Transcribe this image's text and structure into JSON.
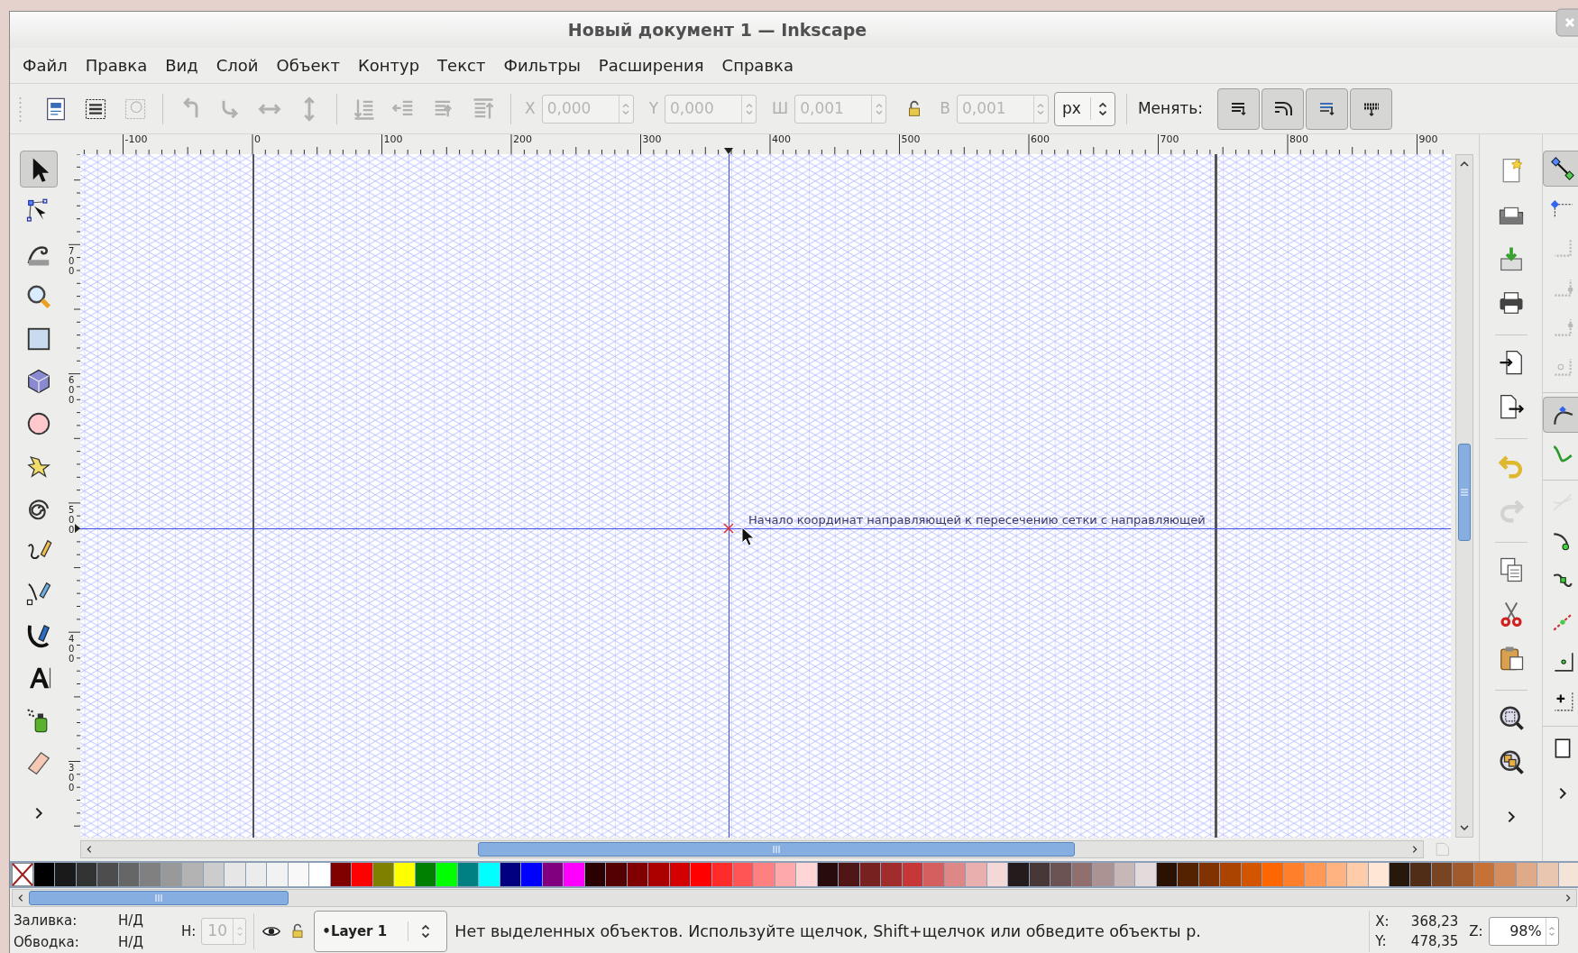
{
  "window": {
    "title": "Новый документ 1 — Inkscape"
  },
  "menu": [
    "Файл",
    "Правка",
    "Вид",
    "Слой",
    "Объект",
    "Контур",
    "Текст",
    "Фильтры",
    "Расширения",
    "Справка"
  ],
  "toolbar": {
    "buttons": [
      {
        "disabled": false
      },
      {
        "disabled": false
      },
      {
        "disabled": true
      },
      {
        "disabled": true
      },
      {
        "disabled": true
      },
      {
        "disabled": true
      },
      {
        "disabled": true
      },
      {
        "disabled": true
      },
      {
        "disabled": true
      },
      {
        "disabled": true
      },
      {
        "disabled": true
      }
    ],
    "fields": [
      {
        "label": "X",
        "value": "0,000",
        "disabled": true
      },
      {
        "label": "Y",
        "value": "0,000",
        "disabled": true
      },
      {
        "label": "Ш",
        "value": "0,001",
        "disabled": true
      },
      {
        "label": "В",
        "value": "0,001",
        "disabled": true
      }
    ],
    "unit": "px",
    "scale_label": "Менять:"
  },
  "h_ruler": {
    "labels": [
      "-100",
      "0",
      "100",
      "200",
      "300",
      "400",
      "500",
      "600",
      "700",
      "800",
      "900"
    ]
  },
  "v_ruler": {
    "labels": [
      "700",
      "600",
      "500",
      "400",
      "300"
    ]
  },
  "tools": [
    {
      "selected": true
    },
    {
      "selected": false
    },
    {
      "selected": false
    },
    {
      "selected": false
    },
    {
      "selected": false
    },
    {
      "selected": false
    },
    {
      "selected": false
    },
    {
      "selected": false
    },
    {
      "selected": false
    },
    {
      "selected": false
    },
    {
      "selected": false
    },
    {
      "selected": false
    },
    {
      "selected": false
    },
    {
      "selected": false
    },
    {
      "selected": false
    }
  ],
  "canvas": {
    "tooltip": "Начало координат направляющей к пересечению сетки с направляющей"
  },
  "commands": [
    {
      "disabled": false
    },
    {
      "disabled": false
    },
    {
      "disabled": false
    },
    {
      "disabled": false
    },
    {
      "disabled": false
    },
    {
      "disabled": false
    },
    {
      "disabled": false
    },
    {
      "disabled": true
    },
    {
      "disabled": false
    },
    {
      "disabled": false
    },
    {
      "disabled": false
    },
    {
      "disabled": false
    },
    {
      "disabled": false
    }
  ],
  "snap_buttons": [
    {
      "on": true,
      "disabled": false
    },
    {
      "on": false,
      "disabled": false
    },
    {
      "on": false,
      "disabled": true
    },
    {
      "on": false,
      "disabled": true
    },
    {
      "on": false,
      "disabled": true
    },
    {
      "on": false,
      "disabled": true
    },
    {
      "on": true,
      "disabled": false
    },
    {
      "on": false,
      "disabled": false
    },
    {
      "on": false,
      "disabled": true
    },
    {
      "on": false,
      "disabled": false
    },
    {
      "on": false,
      "disabled": false
    },
    {
      "on": false,
      "disabled": false
    },
    {
      "on": false,
      "disabled": false
    },
    {
      "on": false,
      "disabled": false
    },
    {
      "on": false,
      "disabled": false
    }
  ],
  "palette": [
    {
      "color": "#000000"
    },
    {
      "color": "#1a1a1a"
    },
    {
      "color": "#333333"
    },
    {
      "color": "#4d4d4d"
    },
    {
      "color": "#666666"
    },
    {
      "color": "#808080"
    },
    {
      "color": "#999999"
    },
    {
      "color": "#b3b3b3"
    },
    {
      "color": "#cccccc"
    },
    {
      "color": "#e6e6e6"
    },
    {
      "color": "#ececec"
    },
    {
      "color": "#f2f2f2"
    },
    {
      "color": "#f8f8f8"
    },
    {
      "color": "#ffffff"
    },
    {
      "color": "#800000"
    },
    {
      "color": "#ff0000"
    },
    {
      "color": "#808000"
    },
    {
      "color": "#ffff00"
    },
    {
      "color": "#008000"
    },
    {
      "color": "#00ff00"
    },
    {
      "color": "#008080"
    },
    {
      "color": "#00ffff"
    },
    {
      "color": "#000080"
    },
    {
      "color": "#0000ff"
    },
    {
      "color": "#800080"
    },
    {
      "color": "#ff00ff"
    },
    {
      "color": "#2b0000"
    },
    {
      "color": "#550000"
    },
    {
      "color": "#800000"
    },
    {
      "color": "#aa0000"
    },
    {
      "color": "#d40000"
    },
    {
      "color": "#ff0000"
    },
    {
      "color": "#ff2a2a"
    },
    {
      "color": "#ff5555"
    },
    {
      "color": "#ff8080"
    },
    {
      "color": "#ffaaaa"
    },
    {
      "color": "#ffd5d5"
    },
    {
      "color": "#280b0b"
    },
    {
      "color": "#501616"
    },
    {
      "color": "#782121"
    },
    {
      "color": "#a02c2c"
    },
    {
      "color": "#c83737"
    },
    {
      "color": "#d35f5f"
    },
    {
      "color": "#de8787"
    },
    {
      "color": "#e9afaf"
    },
    {
      "color": "#f4d7d7"
    },
    {
      "color": "#241c1c"
    },
    {
      "color": "#483737"
    },
    {
      "color": "#6c5353"
    },
    {
      "color": "#916f6f"
    },
    {
      "color": "#ac9393"
    },
    {
      "color": "#c8b7b7"
    },
    {
      "color": "#e3dbdb"
    },
    {
      "color": "#2b1100"
    },
    {
      "color": "#552200"
    },
    {
      "color": "#803300"
    },
    {
      "color": "#aa4400"
    },
    {
      "color": "#d45500"
    },
    {
      "color": "#ff6600"
    },
    {
      "color": "#ff7f2a"
    },
    {
      "color": "#ff9955"
    },
    {
      "color": "#ffb380"
    },
    {
      "color": "#ffccaa"
    },
    {
      "color": "#ffe6d5"
    },
    {
      "color": "#28170b"
    },
    {
      "color": "#502d16"
    },
    {
      "color": "#784421"
    },
    {
      "color": "#a05a2c"
    },
    {
      "color": "#c87137"
    },
    {
      "color": "#d38d5f"
    },
    {
      "color": "#deaa87"
    },
    {
      "color": "#e9c6af"
    },
    {
      "color": "#f4e3d7"
    }
  ],
  "status_bar": {
    "fill_label": "Заливка:",
    "fill_value": "Н/Д",
    "stroke_label": "Обводка:",
    "stroke_value": "Н/Д",
    "opacity_label": "H:",
    "opacity_value": "10",
    "layer": "•Layer 1",
    "message": "Нет выделенных объектов. Используйте щелчок, Shift+щелчок или обведите объекты р.",
    "x_label": "X:",
    "x_value": "368,23",
    "y_label": "Y:",
    "y_value": "478,35",
    "zoom_label": "Z:",
    "zoom_value": "98%"
  }
}
